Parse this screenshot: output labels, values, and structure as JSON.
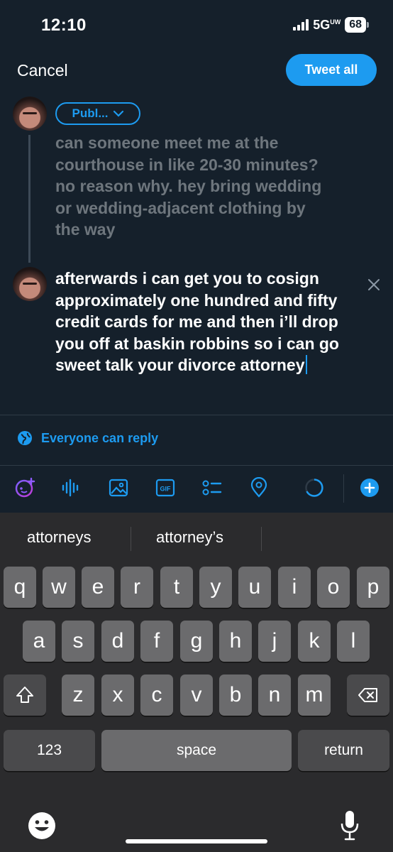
{
  "status_bar": {
    "time": "12:10",
    "network": "5G",
    "network_sup": "UW",
    "battery": "68"
  },
  "header": {
    "cancel_label": "Cancel",
    "tweet_all_label": "Tweet all"
  },
  "composer": {
    "audience_label": "Publ...",
    "tweet1_text": "can someone meet me at the courthouse in like 20-30 minutes? no reason why. hey bring wedding or wedding-adjacent clothing by the way",
    "tweet2_text": "afterwards i can get you to cosign approximately one hundred and fifty credit cards for me and then i’ll drop you off at baskin robbins so i can go sweet talk your divorce attorney",
    "reply_setting": "Everyone can reply",
    "gif_label": "GIF"
  },
  "colors": {
    "accent": "#1d9bf0",
    "background": "#15202b",
    "muted_text": "#6e767d"
  },
  "icons": [
    "ai-sparkle-icon",
    "voice-wave-icon",
    "image-icon",
    "gif-icon",
    "poll-icon",
    "location-icon",
    "progress-ring-icon",
    "add-icon",
    "globe-icon",
    "close-icon"
  ],
  "keyboard": {
    "suggestions": [
      "attorneys",
      "attorney’s"
    ],
    "row1": [
      "q",
      "w",
      "e",
      "r",
      "t",
      "y",
      "u",
      "i",
      "o",
      "p"
    ],
    "row2": [
      "a",
      "s",
      "d",
      "f",
      "g",
      "h",
      "j",
      "k",
      "l"
    ],
    "row3": [
      "z",
      "x",
      "c",
      "v",
      "b",
      "n",
      "m"
    ],
    "numbers_label": "123",
    "space_label": "space",
    "return_label": "return"
  }
}
